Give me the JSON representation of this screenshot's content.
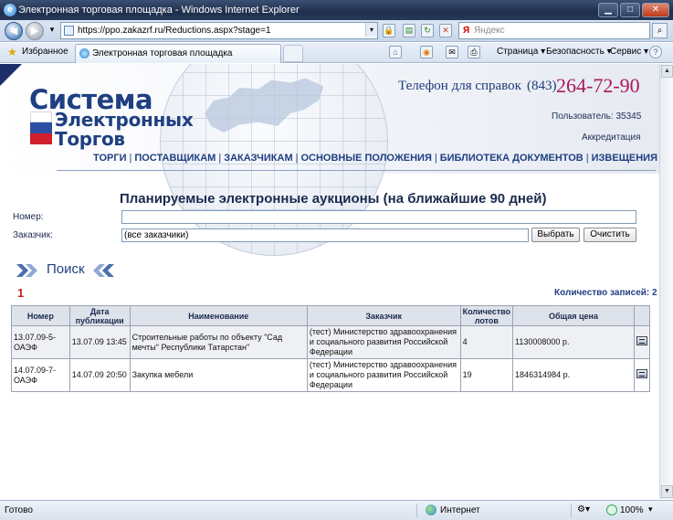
{
  "window": {
    "title": "Электронная торговая площадка - Windows Internet Explorer"
  },
  "browser": {
    "url": "https://ppo.zakazrf.ru/Reductions.aspx?stage=1",
    "search_placeholder": "Яндекс",
    "favorites_label": "Избранное",
    "tab_title": "Электронная торговая площадка",
    "menu": {
      "page": "Страница",
      "safety": "Безопасность",
      "service": "Сервис"
    }
  },
  "header": {
    "logo_line1": "Система",
    "logo_line2": "Электронных",
    "logo_line3": "Торгов",
    "phone_label": "Телефон для справок",
    "phone_code": "(843)",
    "phone_number": "264-72-90",
    "user_text": "Пользователь: 35345",
    "accreditation": "Аккредитация",
    "nav": [
      "ТОРГИ",
      "ПОСТАВЩИКАМ",
      "ЗАКАЗЧИКАМ",
      "ОСНОВНЫЕ ПОЛОЖЕНИЯ",
      "БИБЛИОТЕКА ДОКУМЕНТОВ",
      "ИЗВЕЩЕНИЯ О ЗАКАЗАХ"
    ]
  },
  "form": {
    "title": "Планируемые электронные аукционы (на ближайшие 90 дней)",
    "number_label": "Номер:",
    "number_value": "",
    "customer_label": "Заказчик:",
    "customer_value": "(все заказчики)",
    "select_button": "Выбрать",
    "clear_button": "Очистить"
  },
  "search": {
    "label": "Поиск"
  },
  "pager": {
    "current_page": "1",
    "count_text": "Количество записей: 2"
  },
  "table": {
    "headers": [
      "Номер",
      "Дата публикации",
      "Наименование",
      "Заказчик",
      "Количество лотов",
      "Общая цена",
      ""
    ],
    "rows": [
      {
        "number": "13.07.09-5-ОАЭФ",
        "date": "13.07.09 13:45",
        "name": "Строительные работы по объекту \"Сад мечты\" Республики Татарстан\"",
        "customer": "(тест) Министерство здравоохранения и социального развития Российской Федерации",
        "lots": "4",
        "price": "1130008000 р."
      },
      {
        "number": "14.07.09-7-ОАЭФ",
        "date": "14.07.09 20:50",
        "name": "Закупка мебели",
        "customer": "(тест) Министерство здравоохранения и социального развития Российской Федерации",
        "lots": "19",
        "price": "1846314984 р."
      }
    ]
  },
  "status": {
    "ready": "Готово",
    "zone": "Интернет",
    "zoom": "100%"
  },
  "colors": {
    "brand_blue": "#1f3f82",
    "phone_accent": "#a8185d",
    "pager_red": "#d01f1f"
  }
}
